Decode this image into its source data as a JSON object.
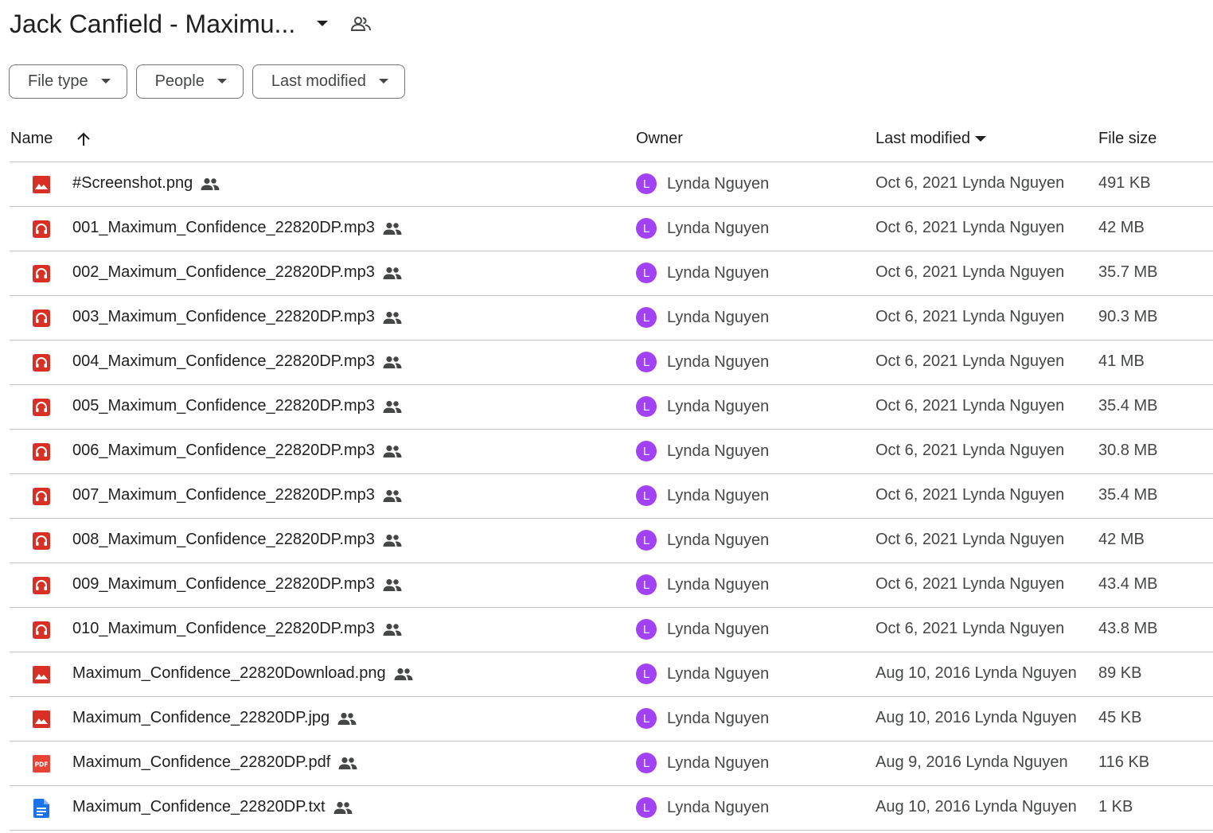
{
  "header": {
    "title": "Jack Canfield - Maximu...",
    "caret_icon": "arrow-drop-down-icon",
    "shared_icon": "shared-people-icon"
  },
  "filters": [
    {
      "label": "File type"
    },
    {
      "label": "People"
    },
    {
      "label": "Last modified"
    }
  ],
  "columns": {
    "name": "Name",
    "owner": "Owner",
    "last_modified": "Last modified",
    "file_size": "File size"
  },
  "colors": {
    "image_icon": "#d93025",
    "audio_icon": "#d93025",
    "pdf_icon": "#ea4335",
    "doc_icon": "#1a73e8",
    "avatar": "#a142f4"
  },
  "files": [
    {
      "name": "#Screenshot.png",
      "type": "image",
      "owner": "Lynda Nguyen",
      "owner_initial": "L",
      "modified": "Oct 6, 2021 Lynda Nguyen",
      "size": "491 KB"
    },
    {
      "name": "001_Maximum_Confidence_22820DP.mp3",
      "type": "audio",
      "owner": "Lynda Nguyen",
      "owner_initial": "L",
      "modified": "Oct 6, 2021 Lynda Nguyen",
      "size": "42 MB"
    },
    {
      "name": "002_Maximum_Confidence_22820DP.mp3",
      "type": "audio",
      "owner": "Lynda Nguyen",
      "owner_initial": "L",
      "modified": "Oct 6, 2021 Lynda Nguyen",
      "size": "35.7 MB"
    },
    {
      "name": "003_Maximum_Confidence_22820DP.mp3",
      "type": "audio",
      "owner": "Lynda Nguyen",
      "owner_initial": "L",
      "modified": "Oct 6, 2021 Lynda Nguyen",
      "size": "90.3 MB"
    },
    {
      "name": "004_Maximum_Confidence_22820DP.mp3",
      "type": "audio",
      "owner": "Lynda Nguyen",
      "owner_initial": "L",
      "modified": "Oct 6, 2021 Lynda Nguyen",
      "size": "41 MB"
    },
    {
      "name": "005_Maximum_Confidence_22820DP.mp3",
      "type": "audio",
      "owner": "Lynda Nguyen",
      "owner_initial": "L",
      "modified": "Oct 6, 2021 Lynda Nguyen",
      "size": "35.4 MB"
    },
    {
      "name": "006_Maximum_Confidence_22820DP.mp3",
      "type": "audio",
      "owner": "Lynda Nguyen",
      "owner_initial": "L",
      "modified": "Oct 6, 2021 Lynda Nguyen",
      "size": "30.8 MB"
    },
    {
      "name": "007_Maximum_Confidence_22820DP.mp3",
      "type": "audio",
      "owner": "Lynda Nguyen",
      "owner_initial": "L",
      "modified": "Oct 6, 2021 Lynda Nguyen",
      "size": "35.4 MB"
    },
    {
      "name": "008_Maximum_Confidence_22820DP.mp3",
      "type": "audio",
      "owner": "Lynda Nguyen",
      "owner_initial": "L",
      "modified": "Oct 6, 2021 Lynda Nguyen",
      "size": "42 MB"
    },
    {
      "name": "009_Maximum_Confidence_22820DP.mp3",
      "type": "audio",
      "owner": "Lynda Nguyen",
      "owner_initial": "L",
      "modified": "Oct 6, 2021 Lynda Nguyen",
      "size": "43.4 MB"
    },
    {
      "name": "010_Maximum_Confidence_22820DP.mp3",
      "type": "audio",
      "owner": "Lynda Nguyen",
      "owner_initial": "L",
      "modified": "Oct 6, 2021 Lynda Nguyen",
      "size": "43.8 MB"
    },
    {
      "name": "Maximum_Confidence_22820Download.png",
      "type": "image",
      "owner": "Lynda Nguyen",
      "owner_initial": "L",
      "modified": "Aug 10, 2016 Lynda Nguyen",
      "size": "89 KB"
    },
    {
      "name": "Maximum_Confidence_22820DP.jpg",
      "type": "image",
      "owner": "Lynda Nguyen",
      "owner_initial": "L",
      "modified": "Aug 10, 2016 Lynda Nguyen",
      "size": "45 KB"
    },
    {
      "name": "Maximum_Confidence_22820DP.pdf",
      "type": "pdf",
      "owner": "Lynda Nguyen",
      "owner_initial": "L",
      "modified": "Aug 9, 2016 Lynda Nguyen",
      "size": "116 KB"
    },
    {
      "name": "Maximum_Confidence_22820DP.txt",
      "type": "doc",
      "owner": "Lynda Nguyen",
      "owner_initial": "L",
      "modified": "Aug 10, 2016 Lynda Nguyen",
      "size": "1 KB"
    }
  ]
}
